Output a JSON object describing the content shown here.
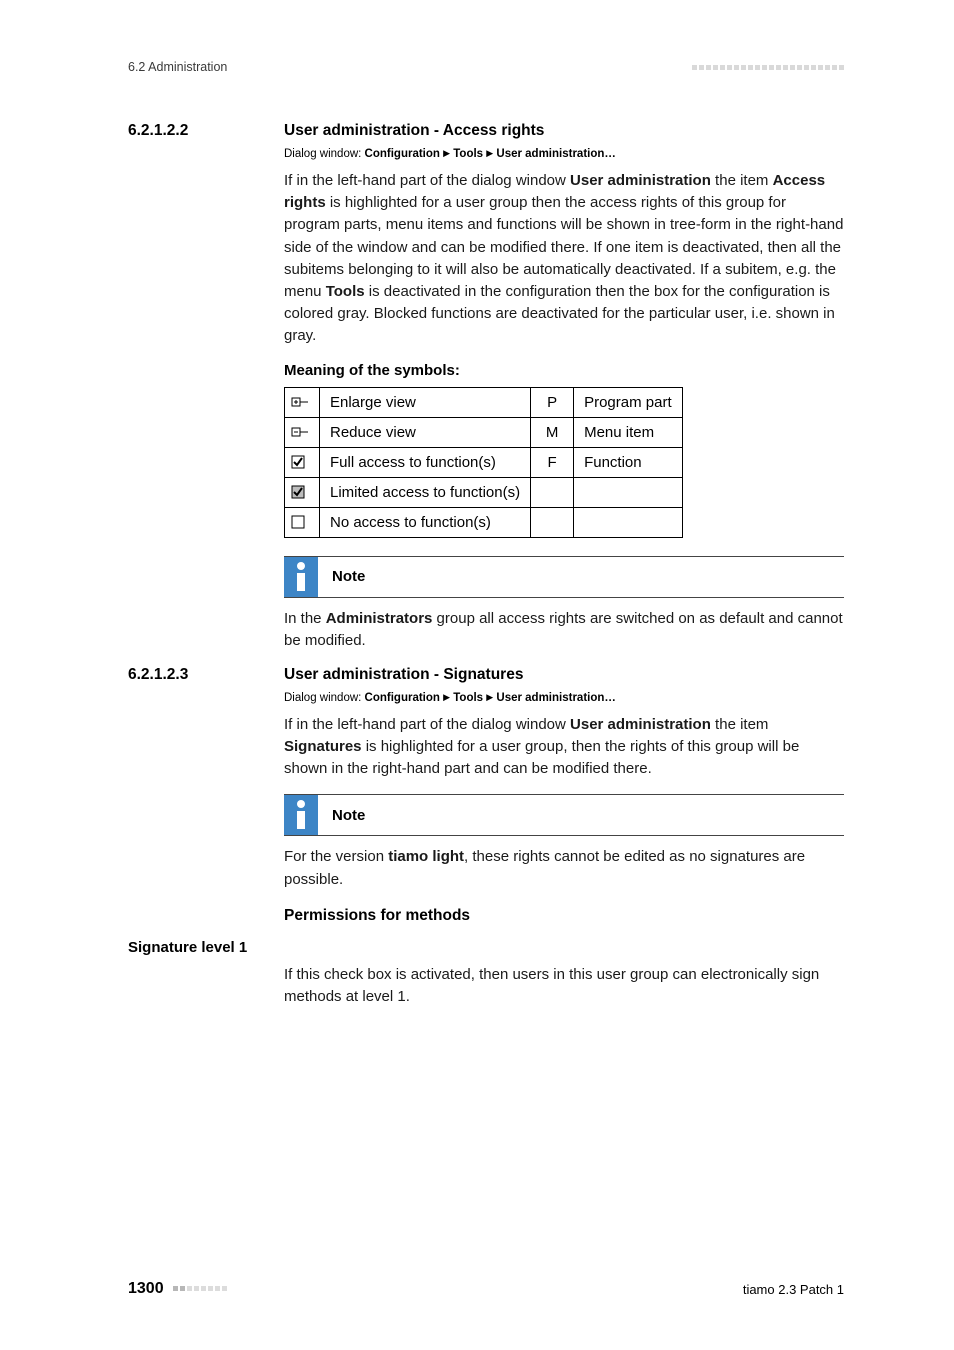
{
  "header": {
    "left": "6.2 Administration"
  },
  "sections": {
    "s1": {
      "num": "6.2.1.2.2",
      "title": "User administration - Access rights",
      "dialog_prefix": "Dialog window: ",
      "dialog_parts": [
        "Configuration",
        "Tools",
        "User administration…"
      ],
      "para1_a": "If in the left-hand part of the dialog window ",
      "para1_b": "User administration",
      "para1_c": " the item ",
      "para1_d": "Access rights",
      "para1_e": " is highlighted for a user group then the access rights of this group for program parts, menu items and functions will be shown in tree-form in the right-hand side of the window and can be modified there. If one item is deactivated, then all the subitems belonging to it will also be automatically deactivated. If a subitem, e.g. the menu ",
      "para1_f": "Tools",
      "para1_g": " is deactivated in the configuration then the box for the configuration is colored gray. Blocked functions are deactivated for the particular user, i.e. shown in gray.",
      "symbols_head": "Meaning of the symbols:",
      "table": {
        "rows": [
          {
            "icon": "plus-tree",
            "desc": "Enlarge view",
            "letter": "P",
            "meaning": "Program part"
          },
          {
            "icon": "minus-tree",
            "desc": "Reduce view",
            "letter": "M",
            "meaning": "Menu item"
          },
          {
            "icon": "check-full",
            "desc": "Full access to function(s)",
            "letter": "F",
            "meaning": "Function"
          },
          {
            "icon": "check-partial",
            "desc": "Limited access to function(s)",
            "letter": "",
            "meaning": ""
          },
          {
            "icon": "check-none",
            "desc": "No access to function(s)",
            "letter": "",
            "meaning": ""
          }
        ]
      },
      "note_label": "Note",
      "note_a": "In the ",
      "note_b": "Administrators",
      "note_c": " group all access rights are switched on as default and cannot be modified."
    },
    "s2": {
      "num": "6.2.1.2.3",
      "title": "User administration - Signatures",
      "dialog_prefix": "Dialog window: ",
      "dialog_parts": [
        "Configuration",
        "Tools",
        "User administration…"
      ],
      "para1_a": "If in the left-hand part of the dialog window ",
      "para1_b": "User administration",
      "para1_c": " the item ",
      "para1_d": "Signatures",
      "para1_e": " is highlighted for a user group, then the rights of this group will be shown in the right-hand part and can be modified there.",
      "note_label": "Note",
      "note_a": "For the version ",
      "note_b": "tiamo light",
      "note_c": ", these rights cannot be edited as no signatures are possible.",
      "perm_head": "Permissions for methods",
      "sig_label": "Signature level 1",
      "sig_text": "If this check box is activated, then users in this user group can electronically sign methods at level 1."
    }
  },
  "footer": {
    "page": "1300",
    "product": "tiamo 2.3 Patch 1"
  }
}
